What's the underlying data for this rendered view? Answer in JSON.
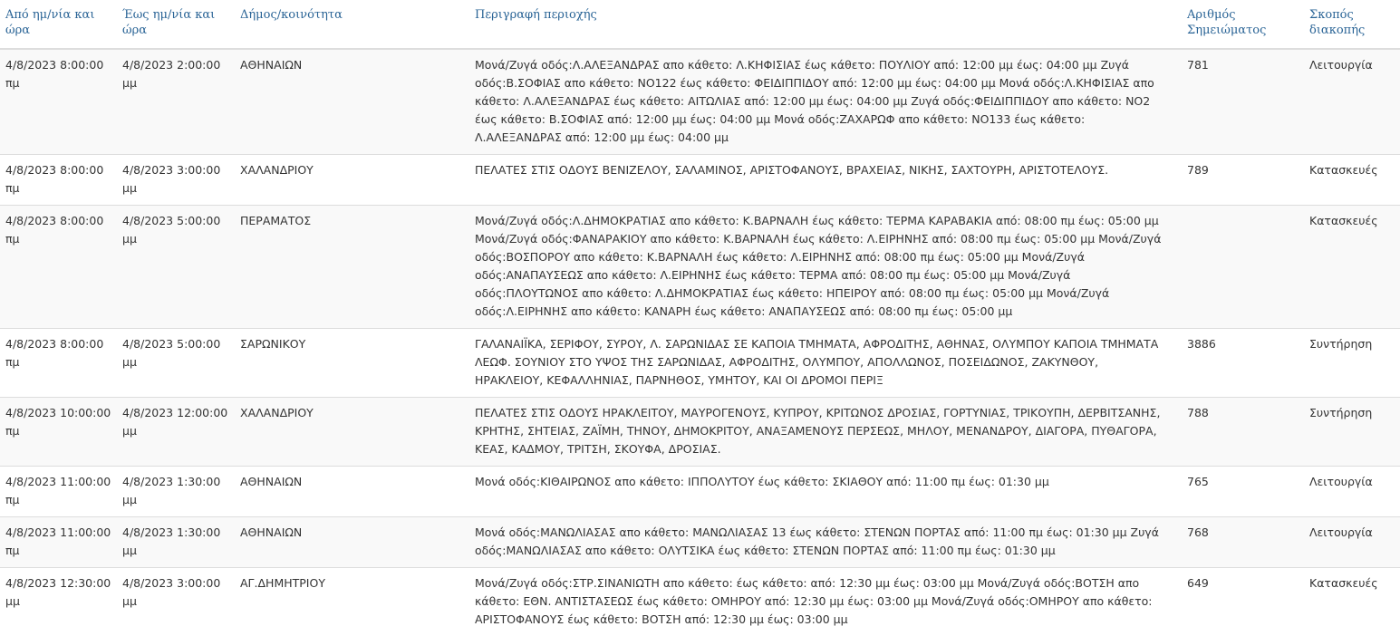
{
  "headers": {
    "from": "Από ημ/νία και ώρα",
    "to": "Έως ημ/νία και ώρα",
    "municipality": "Δήμος/κοινότητα",
    "description": "Περιγραφή περιοχής",
    "notice_number": "Αριθμός Σημειώματος",
    "purpose": "Σκοπός διακοπής"
  },
  "rows": [
    {
      "from": "4/8/2023 8:00:00 πμ",
      "to": "4/8/2023 2:00:00 μμ",
      "municipality": "ΑΘΗΝΑΙΩΝ",
      "description": "Μονά/Ζυγά οδός:Λ.ΑΛΕΞΑΝΔΡΑΣ απο κάθετο: Λ.ΚΗΦΙΣΙΑΣ έως κάθετο: ΠΟΥΛΙΟΥ από: 12:00 μμ έως: 04:00 μμ Ζυγά οδός:Β.ΣΟΦΙΑΣ απο κάθετο: ΝΟ122 έως κάθετο: ΦΕΙΔΙΠΠΙΔΟΥ από: 12:00 μμ έως: 04:00 μμ Μονά οδός:Λ.ΚΗΦΙΣΙΑΣ απο κάθετο: Λ.ΑΛΕΞΑΝΔΡΑΣ έως κάθετο: ΑΙΤΩΛΙΑΣ από: 12:00 μμ έως: 04:00 μμ Ζυγά οδός:ΦΕΙΔΙΠΠΙΔΟΥ απο κάθετο: ΝΟ2 έως κάθετο: Β.ΣΟΦΙΑΣ από: 12:00 μμ έως: 04:00 μμ Μονά οδός:ΖΑΧΑΡΩΦ απο κάθετο: ΝΟ133 έως κάθετο: Λ.ΑΛΕΞΑΝΔΡΑΣ από: 12:00 μμ έως: 04:00 μμ",
      "notice_number": "781",
      "purpose": "Λειτουργία"
    },
    {
      "from": "4/8/2023 8:00:00 πμ",
      "to": "4/8/2023 3:00:00 μμ",
      "municipality": "ΧΑΛΑΝΔΡΙΟΥ",
      "description": "ΠΕΛΑΤΕΣ ΣΤΙΣ ΟΔΟΥΣ ΒΕΝΙΖΕΛΟΥ, ΣΑΛΑΜΙΝΟΣ, ΑΡΙΣΤΟΦΑΝΟΥΣ, ΒΡΑΧΕΙΑΣ, ΝΙΚΗΣ, ΣΑΧΤΟΥΡΗ, ΑΡΙΣΤΟΤΕΛΟΥΣ.",
      "notice_number": "789",
      "purpose": "Κατασκευές"
    },
    {
      "from": "4/8/2023 8:00:00 πμ",
      "to": "4/8/2023 5:00:00 μμ",
      "municipality": "ΠΕΡΑΜΑΤΟΣ",
      "description": "Μονά/Ζυγά οδός:Λ.ΔΗΜΟΚΡΑΤΙΑΣ απο κάθετο: Κ.ΒΑΡΝΑΛΗ έως κάθετο: ΤΕΡΜΑ ΚΑΡΑΒΑΚΙΑ από: 08:00 πμ έως: 05:00 μμ Μονά/Ζυγά οδός:ΦΑΝΑΡΑΚΙΟΥ απο κάθετο: Κ.ΒΑΡΝΑΛΗ έως κάθετο: Λ.ΕΙΡΗΝΗΣ από: 08:00 πμ έως: 05:00 μμ Μονά/Ζυγά οδός:ΒΟΣΠΟΡΟΥ απο κάθετο: Κ.ΒΑΡΝΑΛΗ έως κάθετο: Λ.ΕΙΡΗΝΗΣ από: 08:00 πμ έως: 05:00 μμ Μονά/Ζυγά οδός:ΑΝΑΠΑΥΣΕΩΣ απο κάθετο: Λ.ΕΙΡΗΝΗΣ έως κάθετο: ΤΕΡΜΑ από: 08:00 πμ έως: 05:00 μμ Μονά/Ζυγά οδός:ΠΛΟΥΤΩΝΟΣ απο κάθετο: Λ.ΔΗΜΟΚΡΑΤΙΑΣ έως κάθετο: ΗΠΕΙΡΟΥ από: 08:00 πμ έως: 05:00 μμ Μονά/Ζυγά οδός:Λ.ΕΙΡΗΝΗΣ απο κάθετο: ΚΑΝΑΡΗ έως κάθετο: ΑΝΑΠΑΥΣΕΩΣ από: 08:00 πμ έως: 05:00 μμ",
      "notice_number": "",
      "purpose": "Κατασκευές"
    },
    {
      "from": "4/8/2023 8:00:00 πμ",
      "to": "4/8/2023 5:00:00 μμ",
      "municipality": "ΣΑΡΩΝΙΚΟΥ",
      "description": "ΓΑΛΑΝΑΙΪΚΑ, ΣΕΡΙΦΟΥ, ΣΥΡΟΥ, Λ. ΣΑΡΩΝΙΔΑΣ ΣΕ ΚΑΠΟΙΑ ΤΜΗΜΑΤΑ, ΑΦΡΟΔΙΤΗΣ, ΑΘΗΝΑΣ, ΟΛΥΜΠΟΥ ΚΑΠΟΙΑ ΤΜΗΜΑΤΑ ΛΕΩΦ. ΣΟΥΝΙΟΥ ΣΤΟ ΥΨΟΣ ΤΗΣ ΣΑΡΩΝΙΔΑΣ, ΑΦΡΟΔΙΤΗΣ, ΟΛΥΜΠΟΥ, ΑΠΟΛΛΩΝΟΣ, ΠΟΣΕΙΔΩΝΟΣ, ΖΑΚΥΝΘΟΥ, ΗΡΑΚΛΕΙΟΥ, ΚΕΦΑΛΛΗΝΙΑΣ, ΠΑΡΝΗΘΟΣ, ΥΜΗΤΟΥ, ΚΑΙ ΟΙ ΔΡΟΜΟΙ ΠΕΡΙΞ",
      "notice_number": "3886",
      "purpose": "Συντήρηση"
    },
    {
      "from": "4/8/2023 10:00:00 πμ",
      "to": "4/8/2023 12:00:00 μμ",
      "municipality": "ΧΑΛΑΝΔΡΙΟΥ",
      "description": "ΠΕΛΑΤΕΣ ΣΤΙΣ ΟΔΟΥΣ ΗΡΑΚΛΕΙΤΟΥ, ΜΑΥΡΟΓΕΝΟΥΣ, ΚΥΠΡΟΥ, ΚΡΙΤΩΝΟΣ ΔΡΟΣΙΑΣ, ΓΟΡΤΥΝΙΑΣ, ΤΡΙΚΟΥΠΗ, ΔΕΡΒΙΤΣΑΝΗΣ, ΚΡΗΤΗΣ, ΣΗΤΕΙΑΣ, ΖΑΪΜΗ, ΤΗΝΟΥ, ΔΗΜΟΚΡΙΤΟΥ, ΑΝΑΞΑΜΕΝΟΥΣ ΠΕΡΣΕΩΣ, ΜΗΛΟΥ, ΜΕΝΑΝΔΡΟΥ, ΔΙΑΓΟΡΑ, ΠΥΘΑΓΟΡΑ, ΚΕΑΣ, ΚΑΔΜΟΥ, ΤΡΙΤΣΗ, ΣΚΟΥΦΑ, ΔΡΟΣΙΑΣ.",
      "notice_number": "788",
      "purpose": "Συντήρηση"
    },
    {
      "from": "4/8/2023 11:00:00 πμ",
      "to": "4/8/2023 1:30:00 μμ",
      "municipality": "ΑΘΗΝΑΙΩΝ",
      "description": "Μονά οδός:ΚΙΘΑΙΡΩΝΟΣ απο κάθετο: ΙΠΠΟΛΥΤΟΥ έως κάθετο: ΣΚΙΑΘΟΥ από: 11:00 πμ έως: 01:30 μμ",
      "notice_number": "765",
      "purpose": "Λειτουργία"
    },
    {
      "from": "4/8/2023 11:00:00 πμ",
      "to": "4/8/2023 1:30:00 μμ",
      "municipality": "ΑΘΗΝΑΙΩΝ",
      "description": "Μονά οδός:ΜΑΝΩΛΙΑΣΑΣ απο κάθετο: ΜΑΝΩΛΙΑΣΑΣ 13 έως κάθετο: ΣΤΕΝΩΝ ΠΟΡΤΑΣ από: 11:00 πμ έως: 01:30 μμ Ζυγά οδός:ΜΑΝΩΛΙΑΣΑΣ απο κάθετο: ΟΛΥΤΣΙΚΑ έως κάθετο: ΣΤΕΝΩΝ ΠΟΡΤΑΣ από: 11:00 πμ έως: 01:30 μμ",
      "notice_number": "768",
      "purpose": "Λειτουργία"
    },
    {
      "from": "4/8/2023 12:30:00 μμ",
      "to": "4/8/2023 3:00:00 μμ",
      "municipality": "ΑΓ.ΔΗΜΗΤΡΙΟΥ",
      "description": "Μονά/Ζυγά οδός:ΣΤΡ.ΣΙΝΑΝΙΩΤΗ απο κάθετο: έως κάθετο: από: 12:30 μμ έως: 03:00 μμ Μονά/Ζυγά οδός:ΒΟΤΣΗ απο κάθετο: ΕΘΝ. ΑΝΤΙΣΤΑΣΕΩΣ έως κάθετο: ΟΜΗΡΟΥ από: 12:30 μμ έως: 03:00 μμ Μονά/Ζυγά οδός:ΟΜΗΡΟΥ απο κάθετο: ΑΡΙΣΤΟΦΑΝΟΥΣ έως κάθετο: ΒΟΤΣΗ από: 12:30 μμ έως: 03:00 μμ",
      "notice_number": "649",
      "purpose": "Κατασκευές"
    }
  ]
}
